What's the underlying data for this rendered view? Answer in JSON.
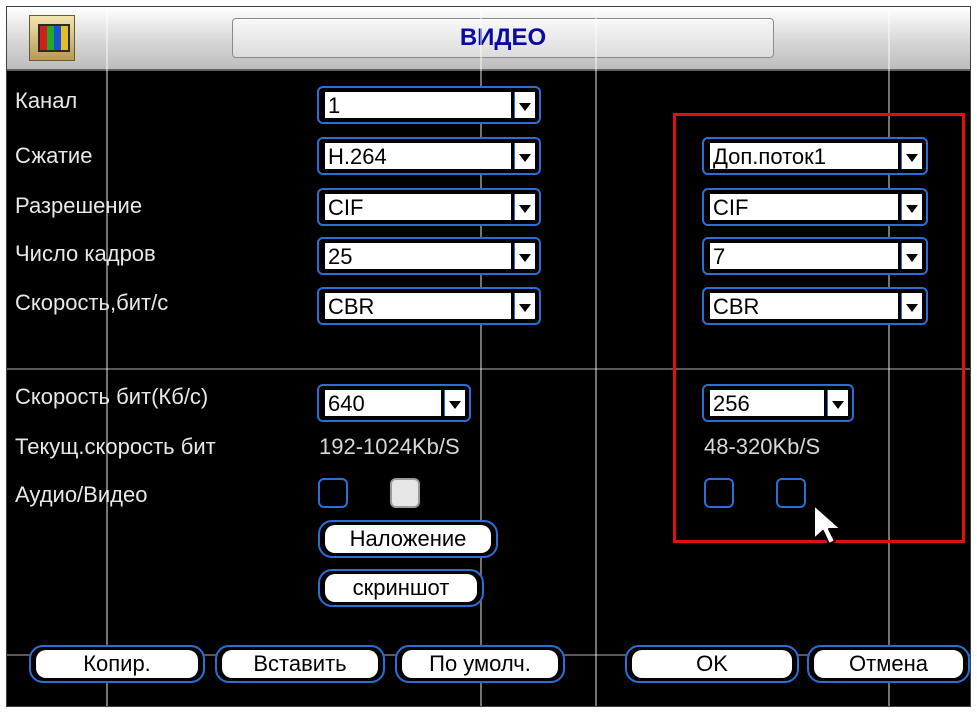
{
  "window": {
    "title": "ВИДЕО"
  },
  "main_stream": {
    "channel": "1",
    "compression": "H.264",
    "resolution": "CIF",
    "frame_rate": "25",
    "bitrate_type": "CBR",
    "bitrate": "640",
    "current_bitrate": "192-1024Kb/S"
  },
  "extra_stream": {
    "stream": "Доп.поток1",
    "resolution": "CIF",
    "frame_rate": "7",
    "bitrate_type": "CBR",
    "bitrate": "256",
    "current_bitrate": "48-320Kb/S"
  },
  "labels": {
    "channel": "Канал",
    "compression": "Сжатие",
    "resolution": "Разрешение",
    "frame_rate": "Число кадров",
    "bitrate_type": "Скорость,бит/с",
    "bitrate": "Скорость бит(Кб/с)",
    "current_bitrate": "Текущ.скорость бит",
    "audio_video": "Аудио/Видео"
  },
  "checkboxes": {
    "main_audio": false,
    "main_video": true,
    "extra_audio": false,
    "extra_video": false
  },
  "buttons": {
    "overlay": "Наложение",
    "snapshot": "скриншот",
    "copy": "Копир.",
    "paste": "Вставить",
    "default": "По умолч.",
    "ok": "OK",
    "cancel": "Отмена"
  },
  "colors": {
    "background": "#000000",
    "accent_border": "#2b6fd6",
    "title_text": "#0a0aa0",
    "highlight": "#e01010"
  },
  "icons": {
    "app": "video-app-icon",
    "cursor": "mouse-pointer-icon"
  }
}
